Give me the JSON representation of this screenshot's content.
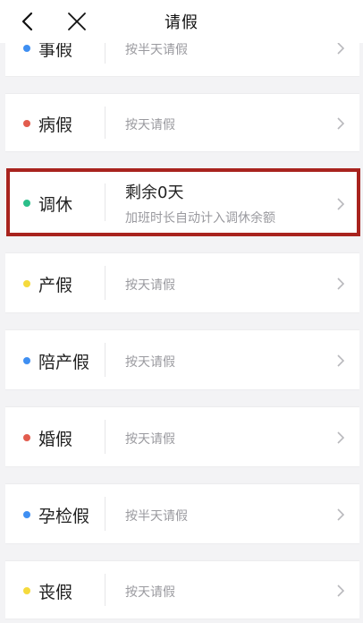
{
  "header": {
    "title": "请假",
    "back_icon": "back-icon",
    "close_icon": "close-icon"
  },
  "colors": {
    "blue": "#3f8ff2",
    "red": "#e25c4e",
    "green": "#2bbf8a",
    "yellow": "#f5da3c",
    "highlight": "#a8231e"
  },
  "items": [
    {
      "name": "事假",
      "note": "按半天请假"
    },
    {
      "name": "病假",
      "note": "按天请假"
    },
    {
      "name": "调休",
      "value": "剩余0天",
      "note": "加班时长自动计入调休余额"
    },
    {
      "name": "产假",
      "note": "按天请假"
    },
    {
      "name": "陪产假",
      "note": "按天请假"
    },
    {
      "name": "婚假",
      "note": "按天请假"
    },
    {
      "name": "孕检假",
      "note": "按半天请假"
    },
    {
      "name": "丧假",
      "note": "按天请假"
    }
  ]
}
